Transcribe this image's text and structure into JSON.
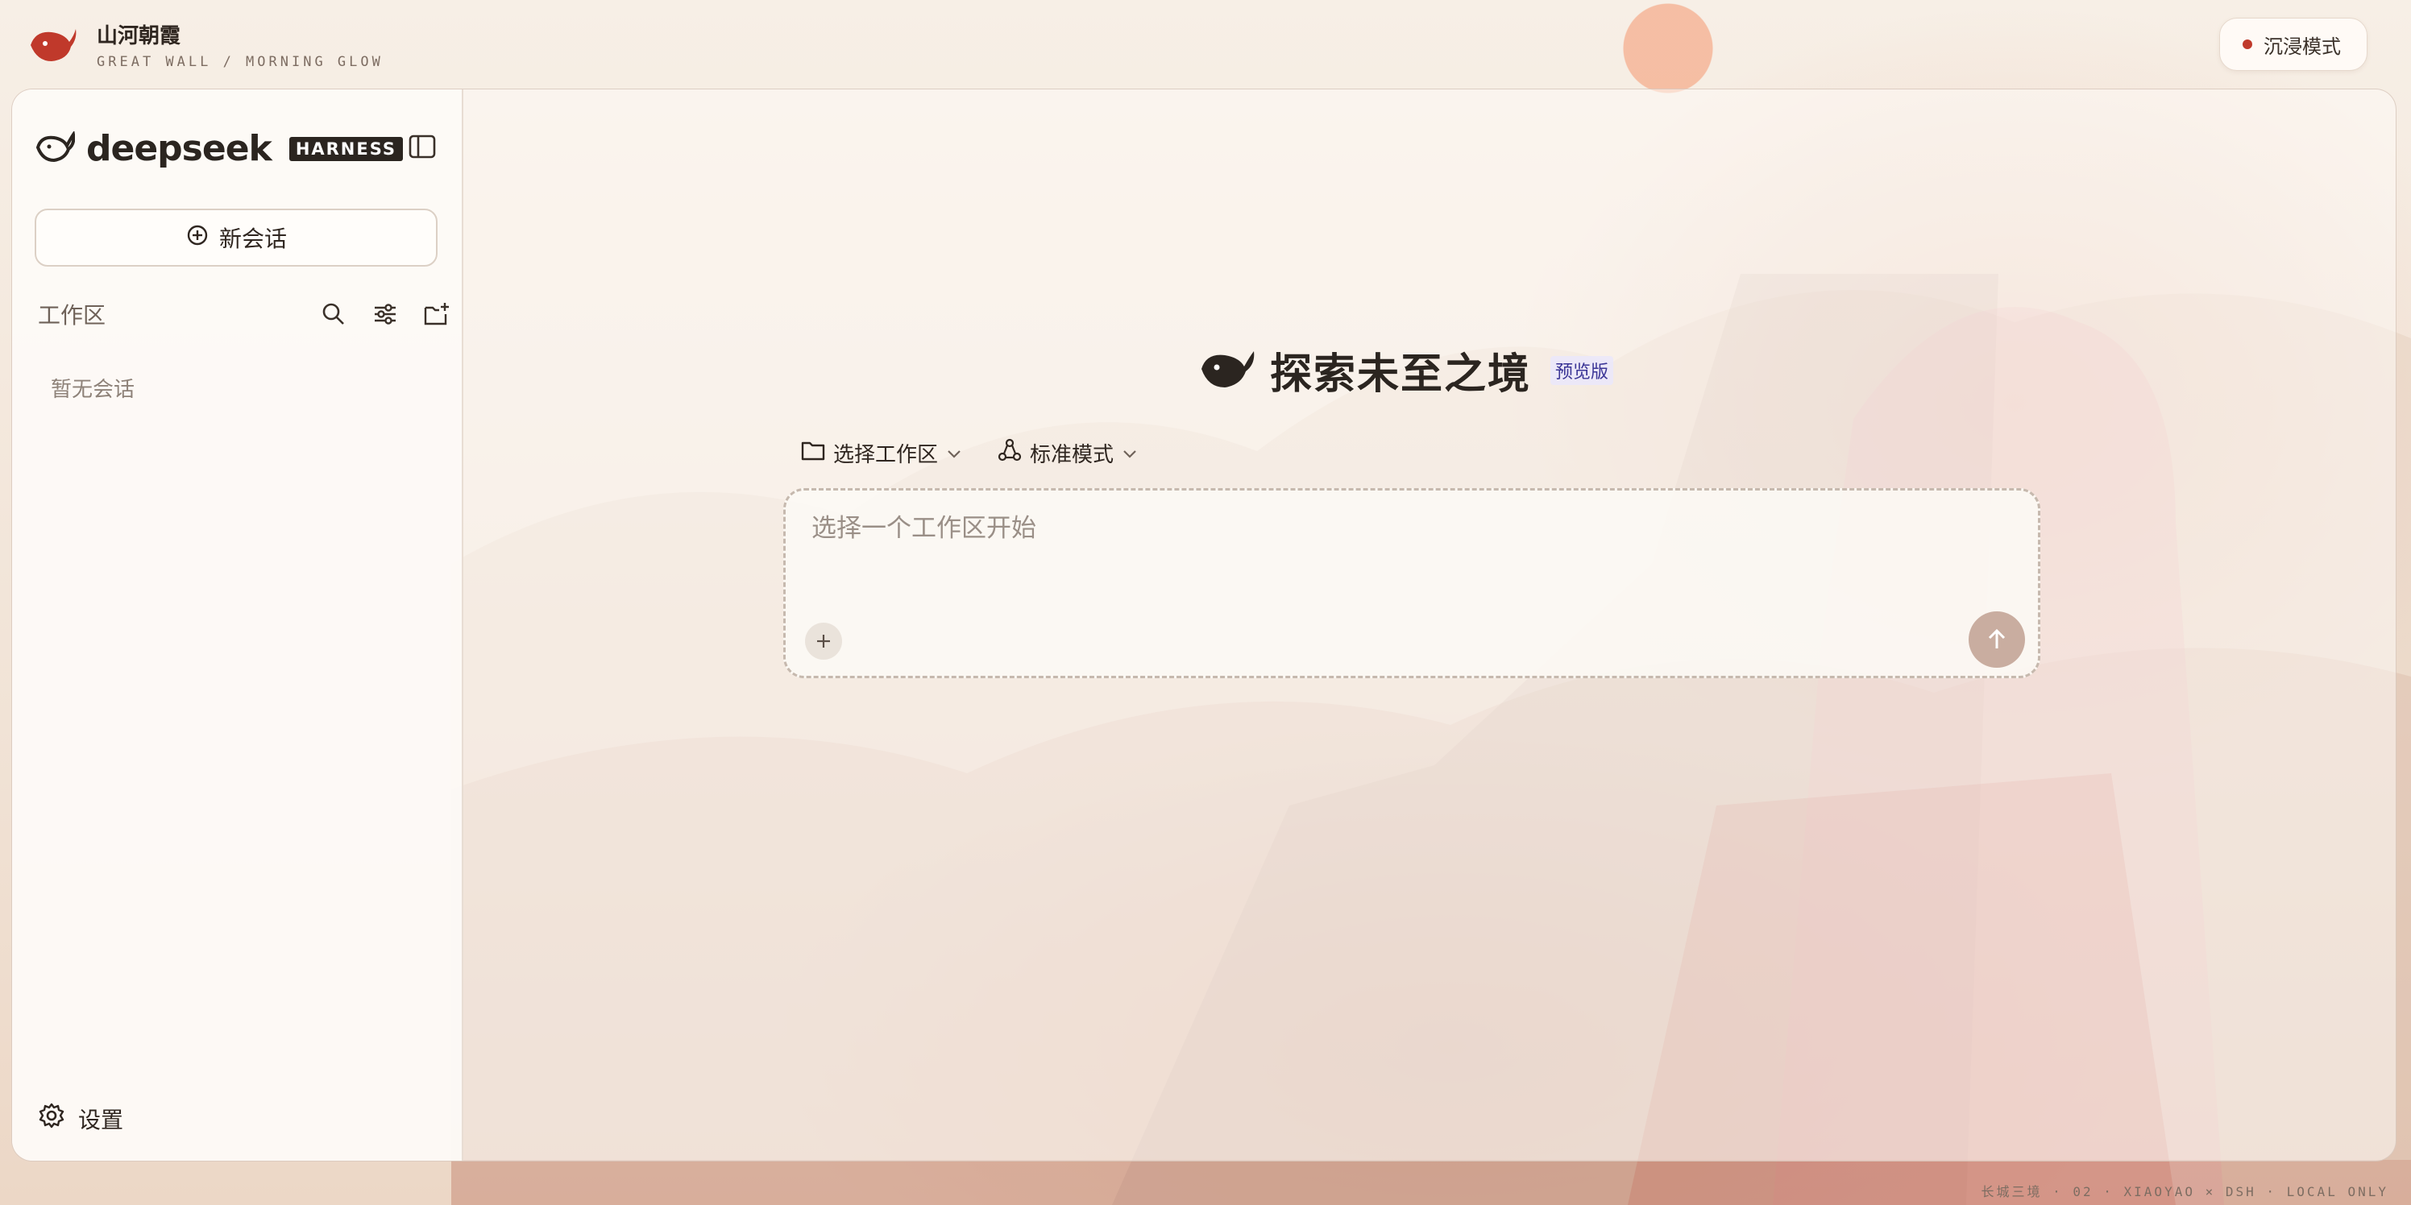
{
  "brand": {
    "title": "山河朝霞",
    "subtitle": "GREAT WALL / MORNING GLOW"
  },
  "immersive": {
    "label": "沉浸模式",
    "status_color": "#c0392b"
  },
  "sidebar": {
    "logo_text": "deepseek",
    "badge": "HARNESS",
    "new_chat_label": "新会话",
    "workspace_label": "工作区",
    "empty_text": "暂无会话",
    "settings_label": "设置"
  },
  "main": {
    "hero_title": "探索未至之境",
    "preview_badge": "预览版",
    "workspace_select": "选择工作区",
    "mode_select": "标准模式",
    "input_placeholder": "选择一个工作区开始"
  },
  "footer": {
    "text": "长城三境 · 02 · XIAOYAO × DSH · LOCAL ONLY"
  }
}
